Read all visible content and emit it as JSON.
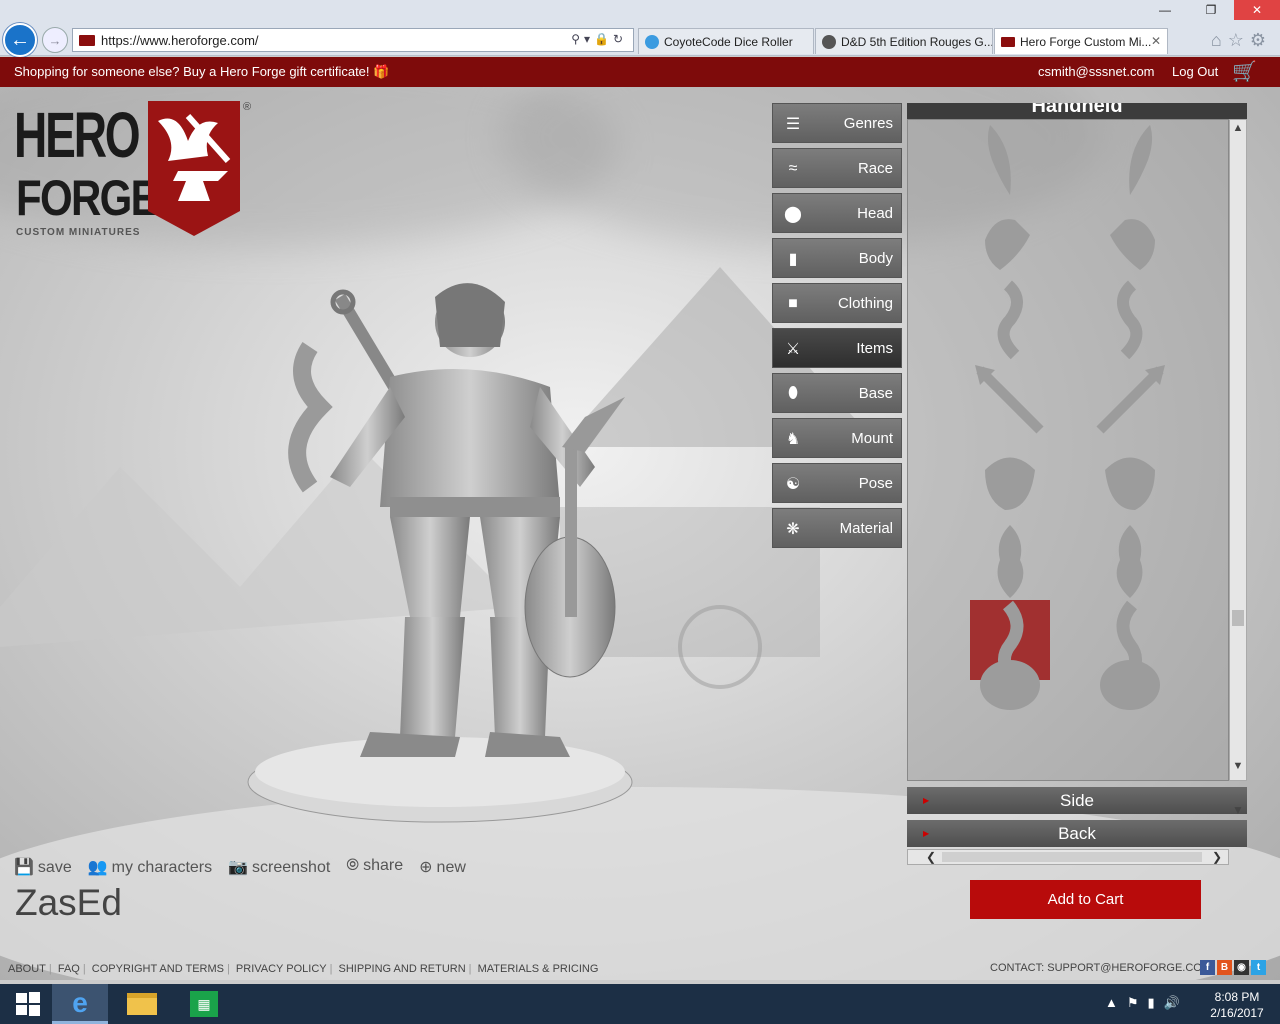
{
  "browser": {
    "url": "https://www.heroforge.com/",
    "tabs": [
      {
        "label": "CoyoteCode Dice Roller",
        "active": false
      },
      {
        "label": "D&D 5th Edition Rouges G...",
        "active": false
      },
      {
        "label": "Hero Forge Custom Mi...",
        "active": true
      }
    ],
    "window_buttons": {
      "minimize": "—",
      "maximize": "❐",
      "close": "✕"
    }
  },
  "topbar": {
    "promo": "Shopping for someone else? Buy a Hero Forge gift certificate!",
    "email": "csmith@sssnet.com",
    "logout": "Log Out",
    "bg_color": "#7e0b0b"
  },
  "logo": {
    "line1": "HERO",
    "line2": "FORGE",
    "sub": "CUSTOM MINIATURES",
    "reg": "®",
    "color": "#9b1414"
  },
  "menu": [
    {
      "label": "Genres",
      "icon": "list-icon"
    },
    {
      "label": "Race",
      "icon": "dna-icon"
    },
    {
      "label": "Head",
      "icon": "head-icon"
    },
    {
      "label": "Body",
      "icon": "body-icon"
    },
    {
      "label": "Clothing",
      "icon": "shirt-icon"
    },
    {
      "label": "Items",
      "icon": "sword-icon",
      "active": true
    },
    {
      "label": "Base",
      "icon": "base-icon"
    },
    {
      "label": "Mount",
      "icon": "horse-icon"
    },
    {
      "label": "Pose",
      "icon": "pose-icon"
    },
    {
      "label": "Material",
      "icon": "material-icon"
    }
  ],
  "panel": {
    "header": "Handheld",
    "selected_index": 12,
    "sub_buttons": [
      "Side",
      "Back"
    ]
  },
  "cart": {
    "label": "Add to Cart",
    "color": "#b80b0b"
  },
  "tools": [
    {
      "label": "save",
      "icon": "save-icon"
    },
    {
      "label": "my characters",
      "icon": "characters-icon"
    },
    {
      "label": "screenshot",
      "icon": "camera-icon"
    },
    {
      "label": "share",
      "icon": "share-icon"
    },
    {
      "label": "new",
      "icon": "plus-icon"
    }
  ],
  "character_name": "ZasEd",
  "footer": {
    "links": [
      "ABOUT",
      "FAQ",
      "COPYRIGHT AND TERMS",
      "PRIVACY POLICY",
      "SHIPPING AND RETURN",
      "MATERIALS & PRICING"
    ],
    "contact": "CONTACT: SUPPORT@HEROFORGE.COM",
    "social": [
      "facebook-icon",
      "blogger-icon",
      "instagram-icon",
      "twitter-icon"
    ]
  },
  "taskbar": {
    "time": "8:08 PM",
    "date": "2/16/2017"
  }
}
